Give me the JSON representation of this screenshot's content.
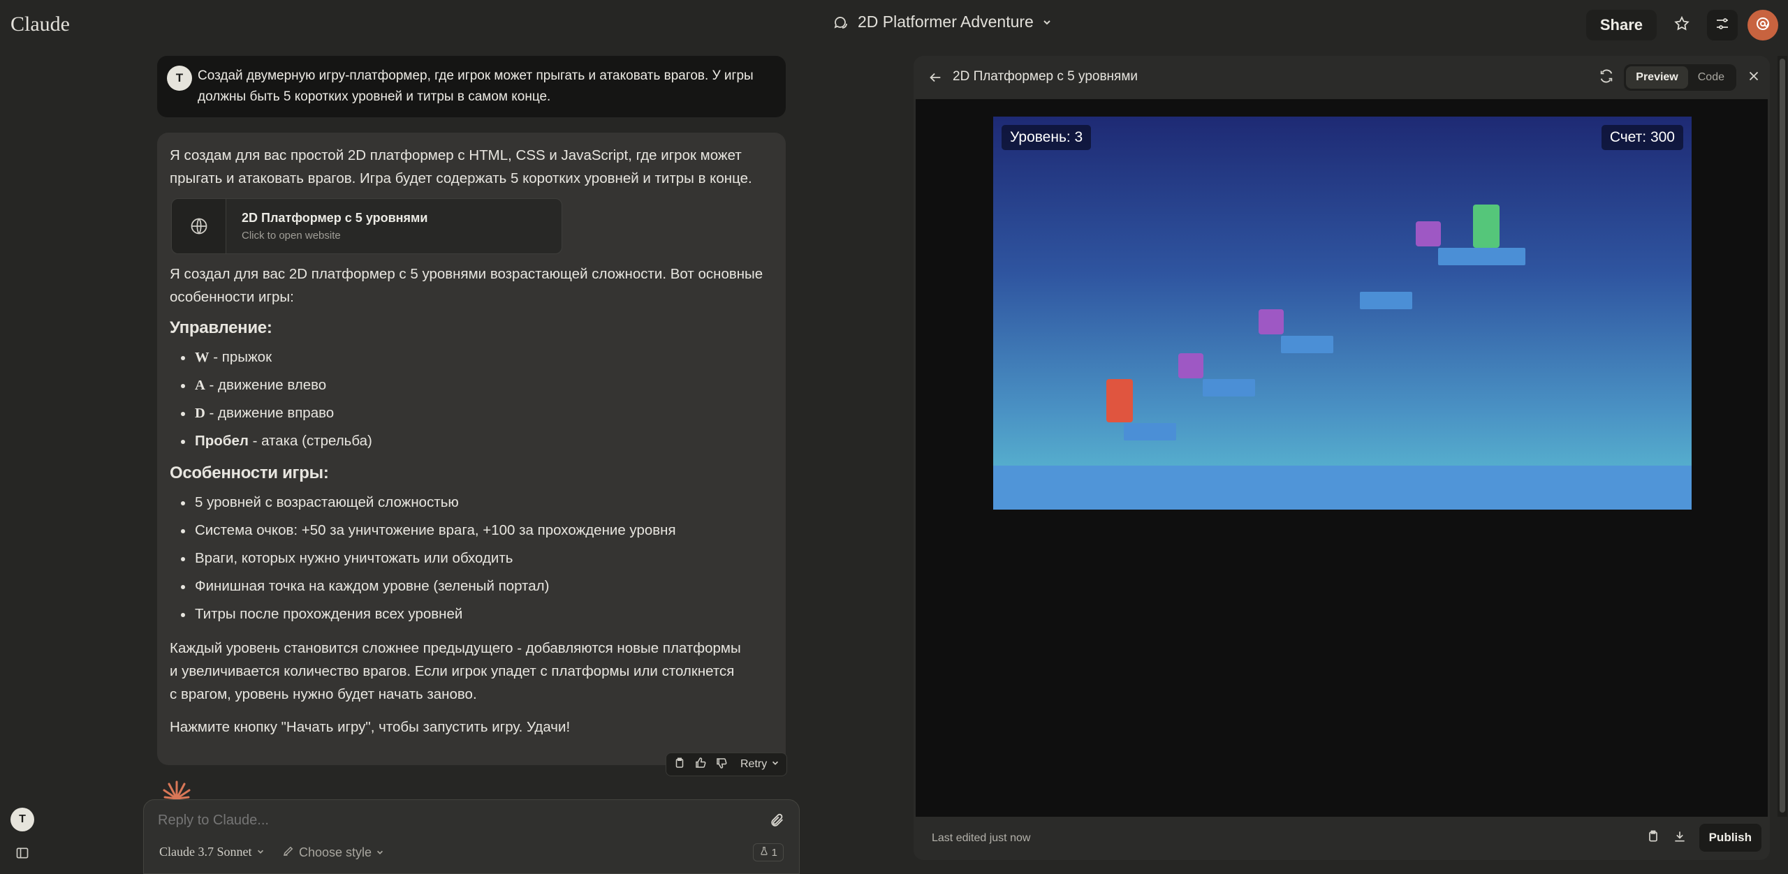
{
  "app": {
    "logo": "Claude"
  },
  "header": {
    "conversation_title": "2D Platformer Adventure",
    "share_label": "Share"
  },
  "user_message": {
    "avatar_initial": "T",
    "text": "Создай двумерную игру-платформер, где игрок может прыгать и атаковать врагов. У игры должны быть 5 коротких уровней и титры в самом конце."
  },
  "assistant_message": {
    "intro": "Я создам для вас простой 2D платформер с HTML, CSS и JavaScript, где игрок может прыгать и атаковать врагов. Игра будет содержать 5 коротких уровней и титры в конце.",
    "artifact_card": {
      "title": "2D Платформер с 5 уровнями",
      "subtitle": "Click to open website"
    },
    "summary": "Я создал для вас 2D платформер с 5 уровнями возрастающей сложности. Вот основные особенности игры:",
    "controls_heading": "Управление:",
    "controls": [
      {
        "key": "W",
        "desc": " - прыжок"
      },
      {
        "key": "A",
        "desc": " - движение влево"
      },
      {
        "key": "D",
        "desc": " - движение вправо"
      },
      {
        "key": "Пробел",
        "desc": " - атака (стрельба)"
      }
    ],
    "features_heading": "Особенности игры:",
    "features": [
      "5 уровней с возрастающей сложностью",
      "Система очков: +50 за уничтожение врага, +100 за прохождение уровня",
      "Враги, которых нужно уничтожать или обходить",
      "Финишная точка на каждом уровне (зеленый портал)",
      "Титры после прохождения всех уровней"
    ],
    "paragraph_difficulty": "Каждый уровень становится сложнее предыдущего - добавляются новые платформы и увеличивается количество врагов. Если игрок упадет с платформы или столкнется с врагом, уровень нужно будет начать заново.",
    "paragraph_start": "Нажмите кнопку \"Начать игру\", чтобы запустить игру. Удачи!",
    "retry_label": "Retry"
  },
  "composer": {
    "placeholder": "Reply to Claude...",
    "model": "Claude 3.7 Sonnet",
    "style": "Choose style",
    "counter": "1"
  },
  "sidebar": {
    "user_initial": "T"
  },
  "artifact_panel": {
    "title": "2D Платформер с 5 уровнями",
    "tab_preview": "Preview",
    "tab_code": "Code",
    "last_edited": "Last edited just now",
    "publish_label": "Publish"
  },
  "game": {
    "level_text": "Уровень: 3",
    "score_text": "Счет: 300"
  },
  "colors": {
    "background": "#262624",
    "accent": "#c8633f",
    "player": "#e0553f",
    "enemy": "#9e58c4",
    "goal": "#55c67a",
    "platform": "#4b8fd6"
  }
}
